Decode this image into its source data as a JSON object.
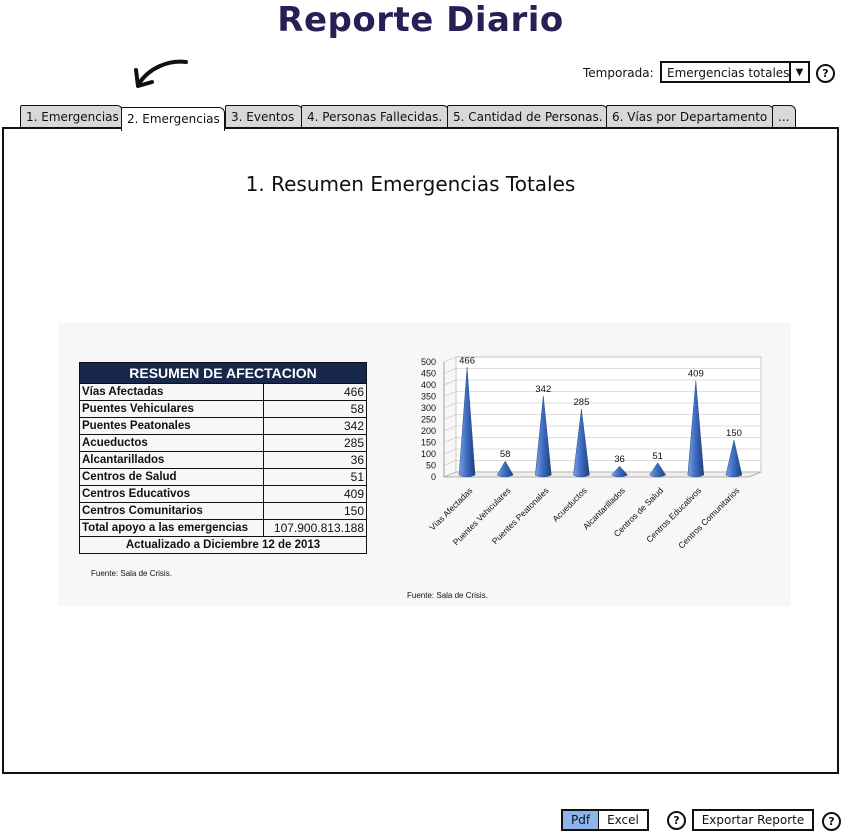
{
  "header": {
    "title": "Reporte Diario"
  },
  "temporada": {
    "label": "Temporada:",
    "value": "Emergencias totales"
  },
  "tabs": [
    {
      "label": "1. Emergencias"
    },
    {
      "label": "2. Emergencias"
    },
    {
      "label": "3. Eventos"
    },
    {
      "label": "4. Personas Fallecidas."
    },
    {
      "label": "5. Cantidad de Personas."
    },
    {
      "label": "6. Vías por Departamento"
    },
    {
      "label": "..."
    }
  ],
  "panel": {
    "title": "1. Resumen Emergencias Totales"
  },
  "summary_table": {
    "header": "RESUMEN DE AFECTACION",
    "rows": [
      {
        "label": "Vías Afectadas",
        "value": "466"
      },
      {
        "label": "Puentes Vehiculares",
        "value": "58"
      },
      {
        "label": "Puentes Peatonales",
        "value": "342"
      },
      {
        "label": "Acueductos",
        "value": "285"
      },
      {
        "label": "Alcantarillados",
        "value": "36"
      },
      {
        "label": "Centros de Salud",
        "value": "51"
      },
      {
        "label": "Centros Educativos",
        "value": "409"
      },
      {
        "label": "Centros Comunitarios",
        "value": "150"
      },
      {
        "label": "Total apoyo a las emergencias",
        "value": "107.900.813.188"
      }
    ],
    "footer": "Actualizado a  Diciembre 12  de 2013",
    "source": "Fuente: Sala de Crisis."
  },
  "chart_data": {
    "type": "bar",
    "categories": [
      "Vías Afectadas",
      "Puentes Vehiculares",
      "Puentes Peatonales",
      "Acueductos",
      "Alcantarillados",
      "Centros de Salud",
      "Centros Educativos",
      "Centros Comunitarios"
    ],
    "values": [
      466,
      58,
      342,
      285,
      36,
      51,
      409,
      150
    ],
    "yticks": [
      0,
      50,
      100,
      150,
      200,
      250,
      300,
      350,
      400,
      450,
      500
    ],
    "ylim": [
      0,
      500
    ],
    "title": "",
    "xlabel": "",
    "ylabel": "",
    "grid": true,
    "bar_color": "#4a74c4",
    "source": "Fuente: Sala de Crisis."
  },
  "footer_buttons": {
    "pdf": "Pdf",
    "excel": "Excel",
    "export": "Exportar Reporte"
  },
  "icons": {
    "help": "?",
    "dropdown": "▼"
  }
}
